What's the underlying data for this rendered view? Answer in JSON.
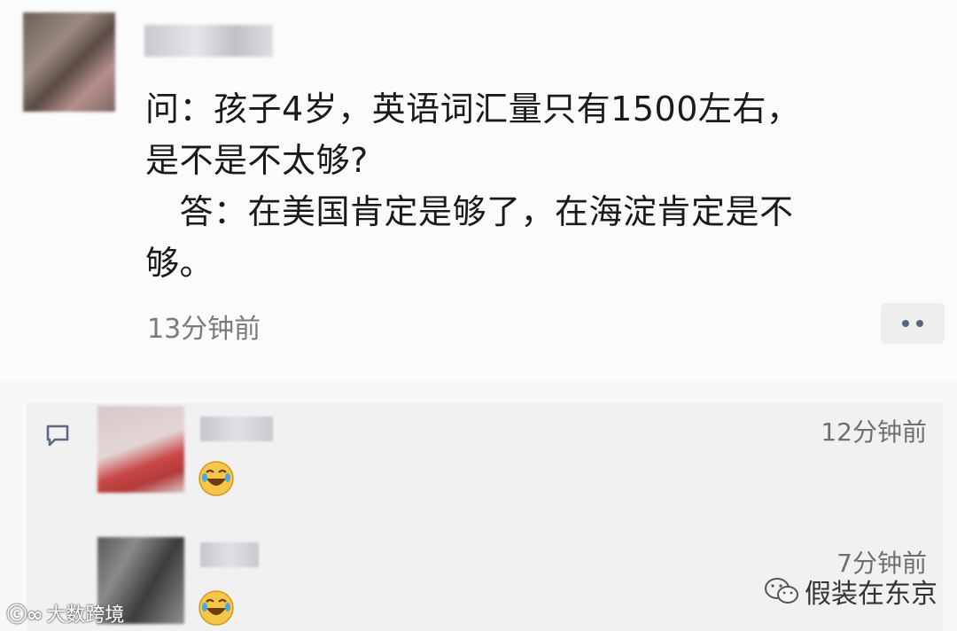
{
  "post": {
    "avatar": "blurred-avatar",
    "username": "",
    "lines": [
      "问：孩子4岁，英语词汇量只有1500左右，",
      "是不是不太够?",
      "　答：在美国肯定是够了，在海淀肯定是不",
      "够。"
    ],
    "time": "13分钟前",
    "more_icon": "more-dots-icon"
  },
  "comments": {
    "icon": "comment-bubble-icon",
    "items": [
      {
        "avatar": "blurred-avatar",
        "username": "",
        "emoji": "laughing-crying-emoji",
        "time": "12分钟前"
      },
      {
        "avatar": "blurred-avatar",
        "username": "",
        "emoji": "laughing-crying-emoji",
        "time": "7分钟前"
      }
    ]
  },
  "watermarks": {
    "left": "大数跨境",
    "right": "假装在东京"
  },
  "colors": {
    "background": "#f8f8f8",
    "comment_bg": "#f1f1f1",
    "text": "#1a1a1a",
    "meta_text": "#7a7a7a",
    "dot_color": "#56677f"
  }
}
